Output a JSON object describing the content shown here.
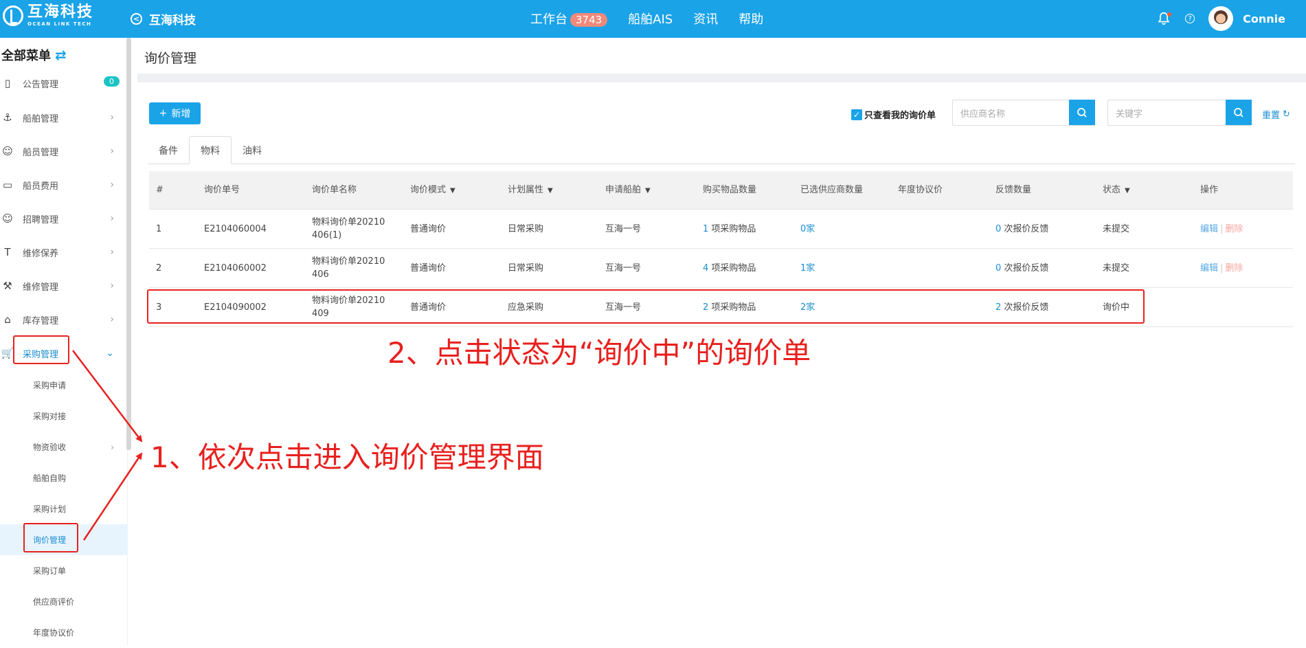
{
  "topbar": {
    "logo_cn": "互海科技",
    "logo_en": "OCEAN LINK TECH",
    "back_title": "互海科技",
    "nav": [
      {
        "label": "工作台",
        "badge": "3743"
      },
      {
        "label": "船舶AIS"
      },
      {
        "label": "资讯"
      },
      {
        "label": "帮助"
      }
    ],
    "username": "Connie"
  },
  "sidebar": {
    "header": "全部菜单",
    "items": [
      {
        "label": "公告管理",
        "icon": "book-icon",
        "count": "0"
      },
      {
        "label": "船舶管理",
        "icon": "anchor-icon"
      },
      {
        "label": "船员管理",
        "icon": "user-icon"
      },
      {
        "label": "船员费用",
        "icon": "wallet-icon"
      },
      {
        "label": "招聘管理",
        "icon": "recruit-icon"
      },
      {
        "label": "维修保养",
        "icon": "hammer-icon"
      },
      {
        "label": "维修管理",
        "icon": "wrench-icon"
      },
      {
        "label": "库存管理",
        "icon": "home-icon"
      },
      {
        "label": "采购管理",
        "icon": "cart-icon"
      }
    ],
    "sub_items": [
      {
        "label": "采购申请"
      },
      {
        "label": "采购对接"
      },
      {
        "label": "物资验收"
      },
      {
        "label": "船舶自购"
      },
      {
        "label": "采购计划"
      },
      {
        "label": "询价管理"
      },
      {
        "label": "采购订单"
      },
      {
        "label": "供应商评价"
      },
      {
        "label": "年度协议价"
      }
    ]
  },
  "page": {
    "title": "询价管理",
    "new_button": "新增",
    "only_mine": "只查看我的询价单",
    "supplier_placeholder": "供应商名称",
    "keyword_placeholder": "关键字",
    "reset": "重置",
    "tabs": [
      "备件",
      "物料",
      "油料"
    ]
  },
  "table": {
    "headers": [
      "#",
      "询价单号",
      "询价单名称",
      "询价模式",
      "计划属性",
      "申请船舶",
      "购买物品数量",
      "已选供应商数量",
      "年度协议价",
      "反馈数量",
      "状态",
      "操作"
    ],
    "rows": [
      {
        "no": "1",
        "code": "E2104060004",
        "name": "物料询价单20210406(1)",
        "mode": "普通询价",
        "plan": "日常采购",
        "ship": "互海一号",
        "items_count": "1",
        "items_unit": "项采购物品",
        "suppliers": "0家",
        "annual": "",
        "feedback_count": "0",
        "feedback_unit": "次报价反馈",
        "status": "未提交",
        "edit": "编辑",
        "delete": "删除"
      },
      {
        "no": "2",
        "code": "E2104060002",
        "name": "物料询价单20210406",
        "mode": "普通询价",
        "plan": "日常采购",
        "ship": "互海一号",
        "items_count": "4",
        "items_unit": "项采购物品",
        "suppliers": "1家",
        "annual": "",
        "feedback_count": "0",
        "feedback_unit": "次报价反馈",
        "status": "未提交",
        "edit": "编辑",
        "delete": "删除"
      },
      {
        "no": "3",
        "code": "E2104090002",
        "name": "物料询价单20210409",
        "mode": "普通询价",
        "plan": "应急采购",
        "ship": "互海一号",
        "items_count": "2",
        "items_unit": "项采购物品",
        "suppliers": "2家",
        "annual": "",
        "feedback_count": "2",
        "feedback_unit": "次报价反馈",
        "status": "询价中",
        "edit": "",
        "delete": ""
      }
    ]
  },
  "annotations": {
    "step1": "1、依次点击进入询价管理界面",
    "step2": "2、点击状态为“询价中”的询价单"
  },
  "colors": {
    "primary": "#1ba3e8",
    "annotation": "#e8201e",
    "badge": "#f0897a"
  }
}
